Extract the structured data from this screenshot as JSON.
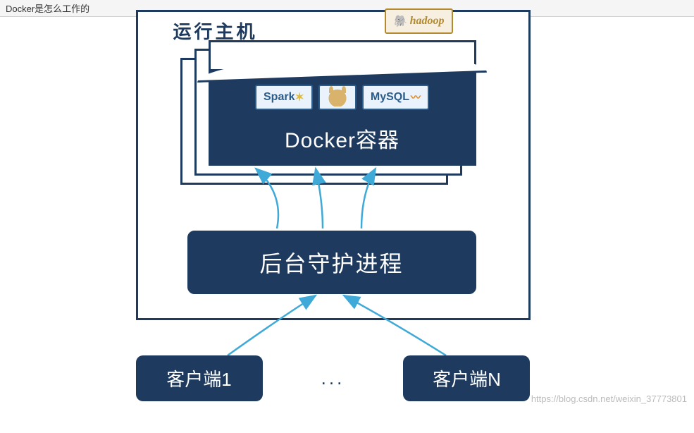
{
  "window": {
    "title": "Docker是怎么工作的"
  },
  "diagram": {
    "host_label": "运行主机",
    "container_label": "Docker容器",
    "daemon_label": "后台守护进程",
    "clients": {
      "first": "客户端1",
      "last": "客户端N",
      "ellipsis": "..."
    },
    "techs": {
      "hadoop": "hadoop",
      "spark": "Spark",
      "mysql": "MySQL"
    }
  },
  "watermark": "https://blog.csdn.net/weixin_37773801"
}
